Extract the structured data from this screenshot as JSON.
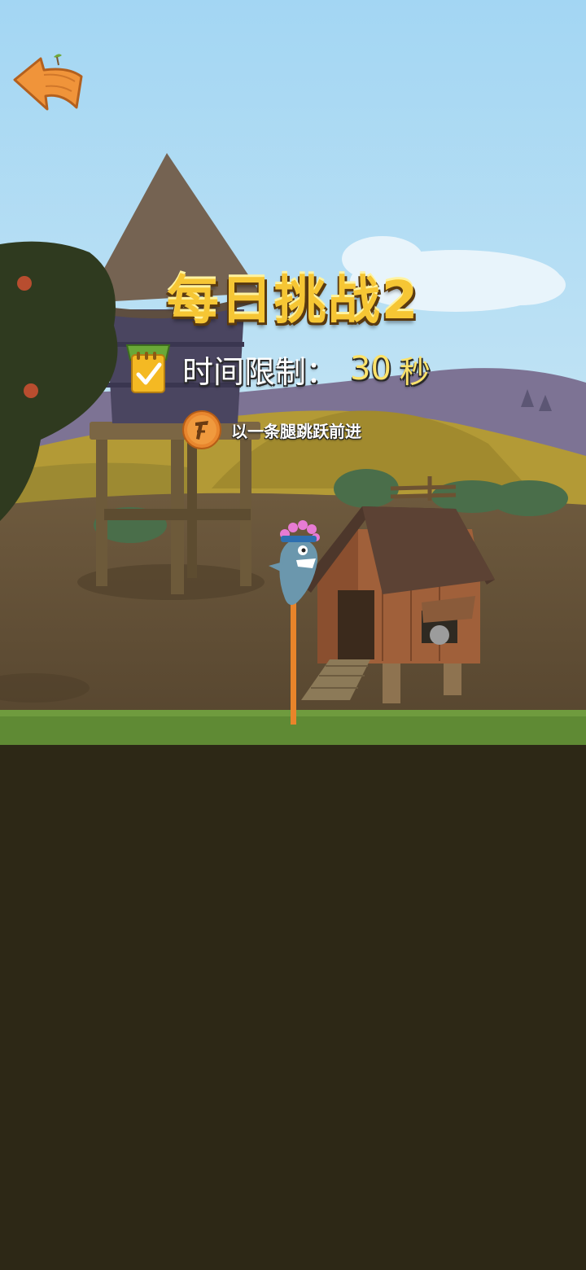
{
  "game": {
    "title": "每日挑战2",
    "time_limit": {
      "label": "时间限制：",
      "value": "30",
      "unit": "秒"
    },
    "hint": "以一条腿跳跃前进"
  },
  "icons": {
    "back": "back-arrow-wood-icon",
    "timer": "calendar-check-icon",
    "hint": "one-leg-badge-icon"
  },
  "colors": {
    "sky": "#a9d8f2",
    "title": "#f6c634",
    "time_value": "#fde36a",
    "grass": "#5f8a34",
    "ground_dark": "#2d2816"
  }
}
